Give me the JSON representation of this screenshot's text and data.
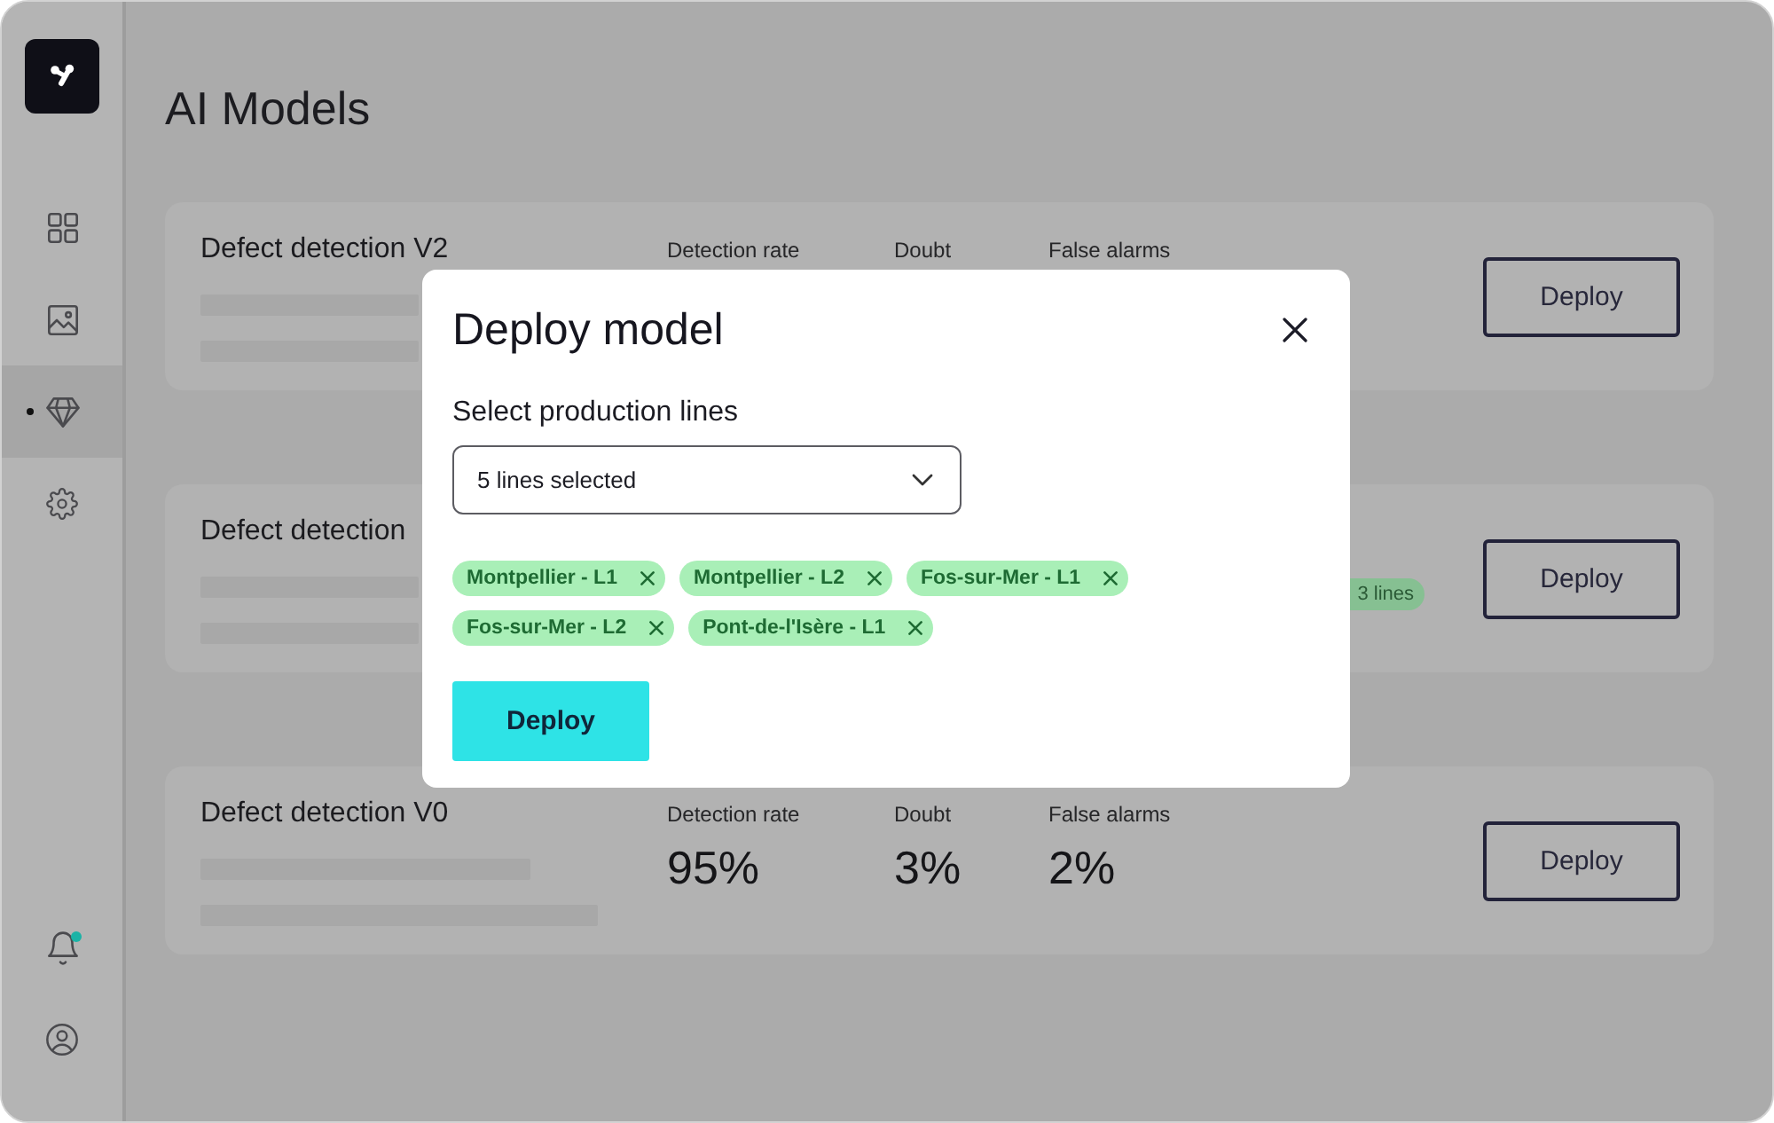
{
  "sidebar": {
    "nav_items": [
      {
        "kind": "dashboard",
        "selected": false
      },
      {
        "kind": "images",
        "selected": false
      },
      {
        "kind": "models",
        "selected": true
      },
      {
        "kind": "settings",
        "selected": false
      }
    ],
    "bottom_items": [
      {
        "kind": "notifications",
        "badge": true
      },
      {
        "kind": "account",
        "badge": false
      }
    ]
  },
  "page_title": "AI Models",
  "models": [
    {
      "name": "Defect detection V2",
      "metrics": [
        {
          "label": "Detection rate"
        },
        {
          "label": "Doubt"
        },
        {
          "label": "False alarms"
        }
      ],
      "button": "Deploy"
    },
    {
      "name": "Defect detection",
      "tag": "3 lines",
      "button": "Deploy"
    },
    {
      "name": "Defect detection V0",
      "metrics": [
        {
          "label": "Detection rate",
          "value": "95%"
        },
        {
          "label": "Doubt",
          "value": "3%"
        },
        {
          "label": "False alarms",
          "value": "2%"
        }
      ],
      "button": "Deploy"
    }
  ],
  "dialog": {
    "title": "Deploy model",
    "field_label": "Select production lines",
    "select_value": "5 lines selected",
    "chips": [
      {
        "label": "Montpellier - L1"
      },
      {
        "label": "Montpellier - L2"
      },
      {
        "label": "Fos-sur-Mer - L1"
      },
      {
        "label": "Fos-sur-Mer - L2"
      },
      {
        "label": "Pont-de-l'Isère - L1"
      }
    ],
    "button": "Deploy"
  }
}
